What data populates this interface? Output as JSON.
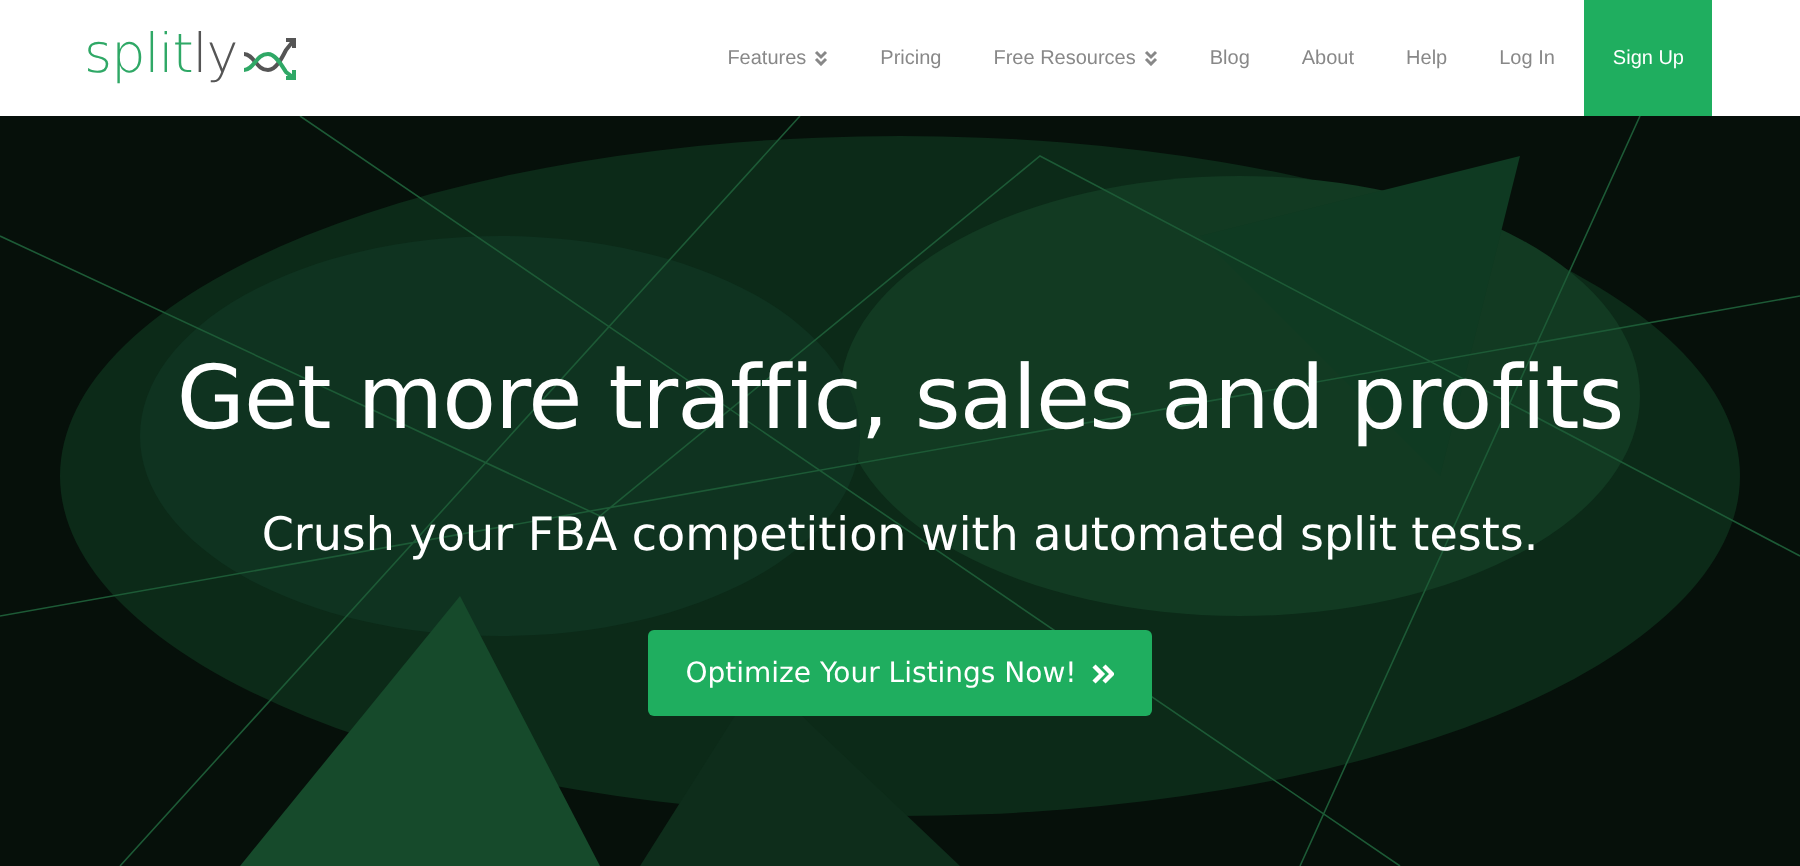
{
  "logo": {
    "parts": [
      {
        "text": "split",
        "color": "#2fa866"
      },
      {
        "text": "ly",
        "color": "#555555"
      }
    ]
  },
  "nav": [
    {
      "label": "Features",
      "dropdown": true,
      "kind": "link"
    },
    {
      "label": "Pricing",
      "dropdown": false,
      "kind": "link"
    },
    {
      "label": "Free Resources",
      "dropdown": true,
      "kind": "link"
    },
    {
      "label": "Blog",
      "dropdown": false,
      "kind": "link"
    },
    {
      "label": "About",
      "dropdown": false,
      "kind": "link"
    },
    {
      "label": "Help",
      "dropdown": false,
      "kind": "link"
    },
    {
      "label": "Log In",
      "dropdown": false,
      "kind": "link"
    },
    {
      "label": "Sign Up",
      "dropdown": false,
      "kind": "primary"
    }
  ],
  "hero": {
    "heading": "Get more traffic, sales and profits",
    "subheading": "Crush your FBA competition with automated split tests.",
    "cta": {
      "label": "Optimize Your Listings Now!"
    }
  }
}
